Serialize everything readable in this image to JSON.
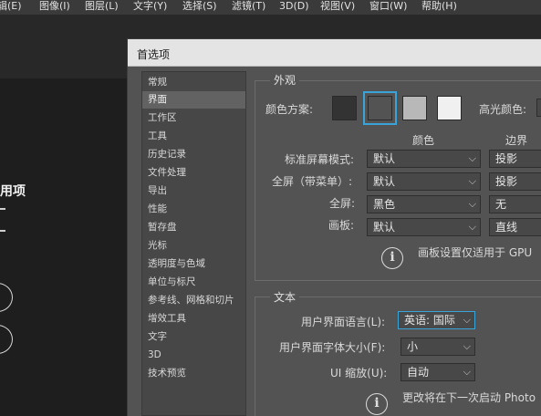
{
  "menubar": {
    "items": [
      "辑(E)",
      "图像(I)",
      "图层(L)",
      "文字(Y)",
      "选择(S)",
      "滤镜(T)",
      "3D(D)",
      "视图(V)",
      "窗口(W)",
      "帮助(H)"
    ]
  },
  "home": {
    "title_fragment": "用项"
  },
  "dialog": {
    "title": "首选项",
    "categories": [
      "常规",
      "界面",
      "工作区",
      "工具",
      "历史记录",
      "文件处理",
      "导出",
      "性能",
      "暂存盘",
      "光标",
      "透明度与色域",
      "单位与标尺",
      "参考线、网格和切片",
      "增效工具",
      "文字",
      "3D",
      "技术预览"
    ],
    "selected_category": "界面",
    "appearance": {
      "legend": "外观",
      "color_theme_label": "颜色方案:",
      "highlight_label": "高光颜色:",
      "swatch_colors": [
        "#333333",
        "#535353",
        "#b8b8b8",
        "#f0f0f0"
      ],
      "selected_swatch_color": "#3aa3d8",
      "col_color": "颜色",
      "col_border": "边界",
      "rows": [
        {
          "label": "标准屏幕模式:",
          "color": "默认",
          "border": "投影"
        },
        {
          "label": "全屏（带菜单）:",
          "color": "默认",
          "border": "投影"
        },
        {
          "label": "全屏:",
          "color": "黑色",
          "border": "无"
        },
        {
          "label": "画板:",
          "color": "默认",
          "border": "直线"
        }
      ],
      "note": "画板设置仅适用于 GPU"
    },
    "text": {
      "legend": "文本",
      "ui_language_label": "用户界面语言(L):",
      "ui_language_value": "英语: 国际",
      "ui_font_size_label": "用户界面字体大小(F):",
      "ui_font_size_value": "小",
      "ui_scaling_label": "UI 缩放(U):",
      "ui_scaling_value": "自动",
      "note": "更改将在下一次启动 Photo"
    }
  }
}
